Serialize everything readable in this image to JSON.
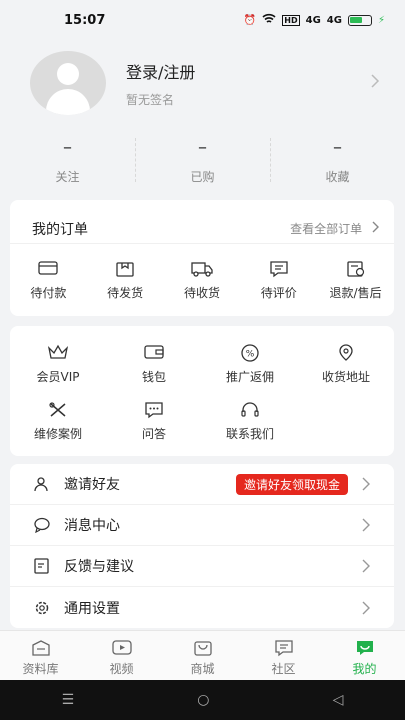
{
  "status": {
    "time": "15:07",
    "hd": "HD",
    "net1": "4G",
    "net2": "4G"
  },
  "profile": {
    "login": "登录/注册",
    "signature": "暂无签名"
  },
  "stats": [
    {
      "value": "–",
      "label": "关注"
    },
    {
      "value": "–",
      "label": "已购"
    },
    {
      "value": "–",
      "label": "收藏"
    }
  ],
  "orders": {
    "title": "我的订单",
    "view_all": "查看全部订单",
    "items": [
      {
        "label": "待付款",
        "icon": "card-icon"
      },
      {
        "label": "待发货",
        "icon": "box-icon"
      },
      {
        "label": "待收货",
        "icon": "truck-icon"
      },
      {
        "label": "待评价",
        "icon": "comment-icon"
      },
      {
        "label": "退款/售后",
        "icon": "refund-icon"
      }
    ]
  },
  "services": [
    {
      "label": "会员VIP",
      "icon": "crown-icon"
    },
    {
      "label": "钱包",
      "icon": "wallet-icon"
    },
    {
      "label": "推广返佣",
      "icon": "percent-icon"
    },
    {
      "label": "收货地址",
      "icon": "location-icon"
    },
    {
      "label": "维修案例",
      "icon": "tools-icon"
    },
    {
      "label": "问答",
      "icon": "chat-icon"
    },
    {
      "label": "联系我们",
      "icon": "headset-icon"
    }
  ],
  "menu": [
    {
      "label": "邀请好友",
      "icon": "user-icon",
      "badge": "邀请好友领取现金"
    },
    {
      "label": "消息中心",
      "icon": "message-icon"
    },
    {
      "label": "反馈与建议",
      "icon": "feedback-icon"
    },
    {
      "label": "通用设置",
      "icon": "gear-icon"
    }
  ],
  "tabs": [
    {
      "label": "资料库",
      "icon": "library-icon"
    },
    {
      "label": "视频",
      "icon": "video-icon"
    },
    {
      "label": "商城",
      "icon": "shop-icon"
    },
    {
      "label": "社区",
      "icon": "community-icon"
    },
    {
      "label": "我的",
      "icon": "mine-icon"
    }
  ],
  "colors": {
    "accent": "#22b14c",
    "badge": "#e5281e"
  }
}
